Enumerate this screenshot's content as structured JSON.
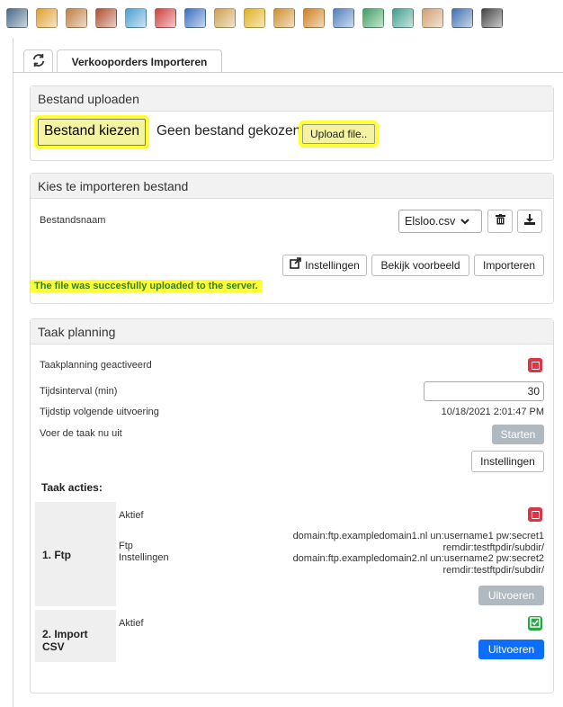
{
  "toolbar": {
    "icons": [
      {
        "name": "device-icon",
        "color": "#4a6a8a"
      },
      {
        "name": "folder-document-icon",
        "color": "#e0a030"
      },
      {
        "name": "shipping-icon",
        "color": "#c08040"
      },
      {
        "name": "package-stack-icon",
        "color": "#b05030"
      },
      {
        "name": "document-store-icon",
        "color": "#4aa0d0"
      },
      {
        "name": "books-icon",
        "color": "#d04040"
      },
      {
        "name": "box-icon",
        "color": "#3a70c0"
      },
      {
        "name": "document-box-icon",
        "color": "#d0a050"
      },
      {
        "name": "box-add-icon",
        "color": "#e0b020"
      },
      {
        "name": "box-add-2-icon",
        "color": "#d09030"
      },
      {
        "name": "box-search-icon",
        "color": "#d08020"
      },
      {
        "name": "magnifier-icon",
        "color": "#5080c0"
      },
      {
        "name": "globe-box-icon",
        "color": "#40a060"
      },
      {
        "name": "document-box-2-icon",
        "color": "#40a090"
      },
      {
        "name": "open-box-icon",
        "color": "#d0a070"
      },
      {
        "name": "box-blue-icon",
        "color": "#4070b0"
      },
      {
        "name": "search-icon",
        "color": "#444444"
      }
    ]
  },
  "tabs": {
    "main_label": "Verkooporders Importeren"
  },
  "upload": {
    "header": "Bestand uploaden",
    "choose_label": "Bestand kiezen",
    "no_file_text": "Geen bestand gekozen",
    "upload_label": "Upload file.."
  },
  "import": {
    "header": "Kies te importeren bestand",
    "filename_label": "Bestandsnaam",
    "selected_file": "Elsloo.csv",
    "settings_label": "Instellingen",
    "preview_label": "Bekijk voorbeeld",
    "import_label": "Importeren",
    "success_message": "The file was succesfully uploaded to the server."
  },
  "schedule": {
    "header": "Taak planning",
    "activated_label": "Taakplanning geactiveerd",
    "interval_label": "Tijdsinterval (min)",
    "interval_value": "30",
    "next_run_label": "Tijdstip volgende uitvoering",
    "next_run_value": "10/18/2021 2:01:47 PM",
    "run_now_label": "Voer de taak nu uit",
    "start_label": "Starten",
    "settings_label": "Instellingen",
    "actions_title": "Taak acties:",
    "actions": [
      {
        "name": "1. Ftp",
        "active_label": "Aktief",
        "settings_label_1": "Ftp",
        "settings_label_2": "Instellingen",
        "settings_lines": [
          "domain:ftp.exampledomain1.nl un:username1 pw:secret1",
          "remdir:testftpdir/subdir/",
          "domain:ftp.exampledomain2.nl un:username2 pw:secret2",
          "remdir:testftpdir/subdir/"
        ],
        "run_label": "Uitvoeren"
      },
      {
        "name_line1": "2. Import",
        "name_line2": "CSV",
        "active_label": "Aktief",
        "run_label": "Uitvoeren"
      }
    ]
  }
}
